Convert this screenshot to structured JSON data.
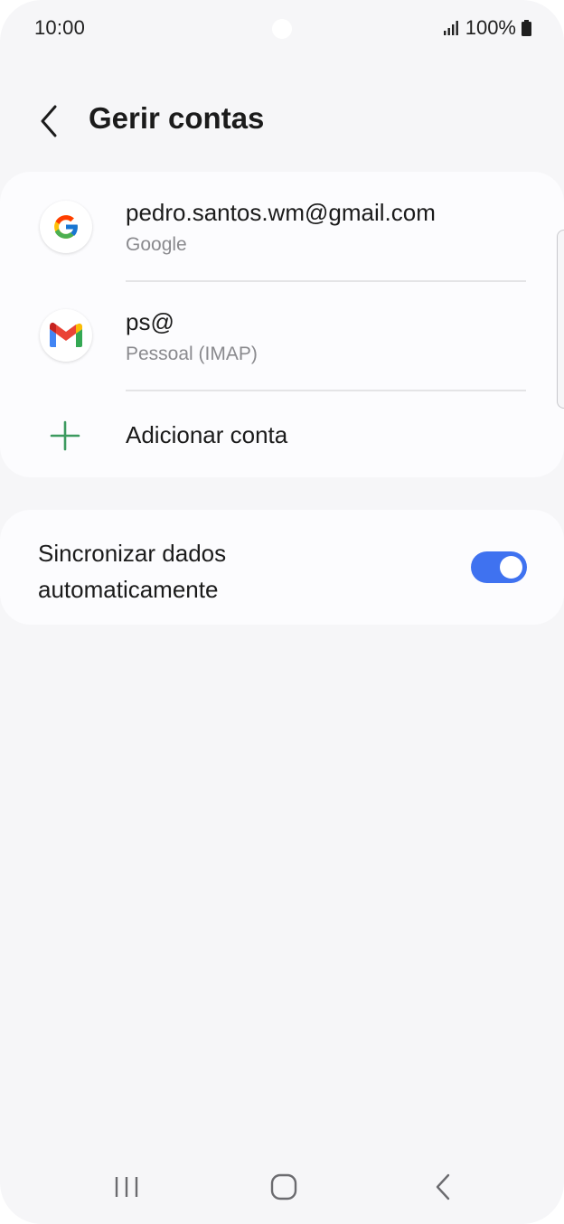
{
  "status_bar": {
    "time": "10:00",
    "battery": "100%",
    "signal_icon": "signal-icon",
    "battery_icon": "battery-icon"
  },
  "header": {
    "title": "Gerir contas",
    "back_icon": "chevron-left-icon"
  },
  "accounts": [
    {
      "name": "pedro.santos.wm@gmail.com",
      "type": "Google",
      "icon": "google-icon"
    },
    {
      "name": "ps@",
      "type": "Pessoal (IMAP)",
      "icon": "gmail-icon"
    }
  ],
  "add_account": {
    "label": "Adicionar conta",
    "icon": "plus-icon"
  },
  "sync": {
    "label": "Sincronizar dados automaticamente",
    "enabled": true
  },
  "nav_bar": {
    "recents_icon": "recents-icon",
    "home_icon": "home-icon",
    "back_icon": "back-icon"
  },
  "colors": {
    "background": "#f6f6f8",
    "card": "#fcfcfe",
    "toggle_on": "#3f72f0",
    "add_icon": "#3c9a5f",
    "secondary_text": "#8a8a8e"
  }
}
